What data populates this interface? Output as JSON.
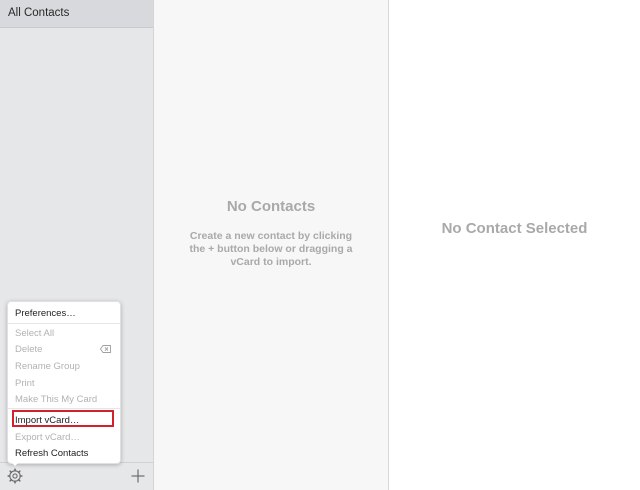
{
  "sidebar": {
    "header": "All Contacts"
  },
  "list": {
    "empty_title": "No Contacts",
    "empty_desc": "Create a new contact by clicking the + button below or dragging a vCard to import."
  },
  "detail": {
    "empty_title": "No Contact Selected"
  },
  "menu": {
    "preferences": "Preferences…",
    "select_all": "Select All",
    "delete": "Delete",
    "rename_group": "Rename Group",
    "print": "Print",
    "make_my_card": "Make This My Card",
    "import_vcard": "Import vCard…",
    "export_vcard": "Export vCard…",
    "refresh": "Refresh Contacts"
  },
  "footer": {
    "settings_icon": "gear-icon",
    "add_icon": "plus-icon"
  },
  "colors": {
    "highlight": "#d3202a",
    "sidebar_bg": "#e6e7e9",
    "disabled_text": "#b2b2b2"
  }
}
